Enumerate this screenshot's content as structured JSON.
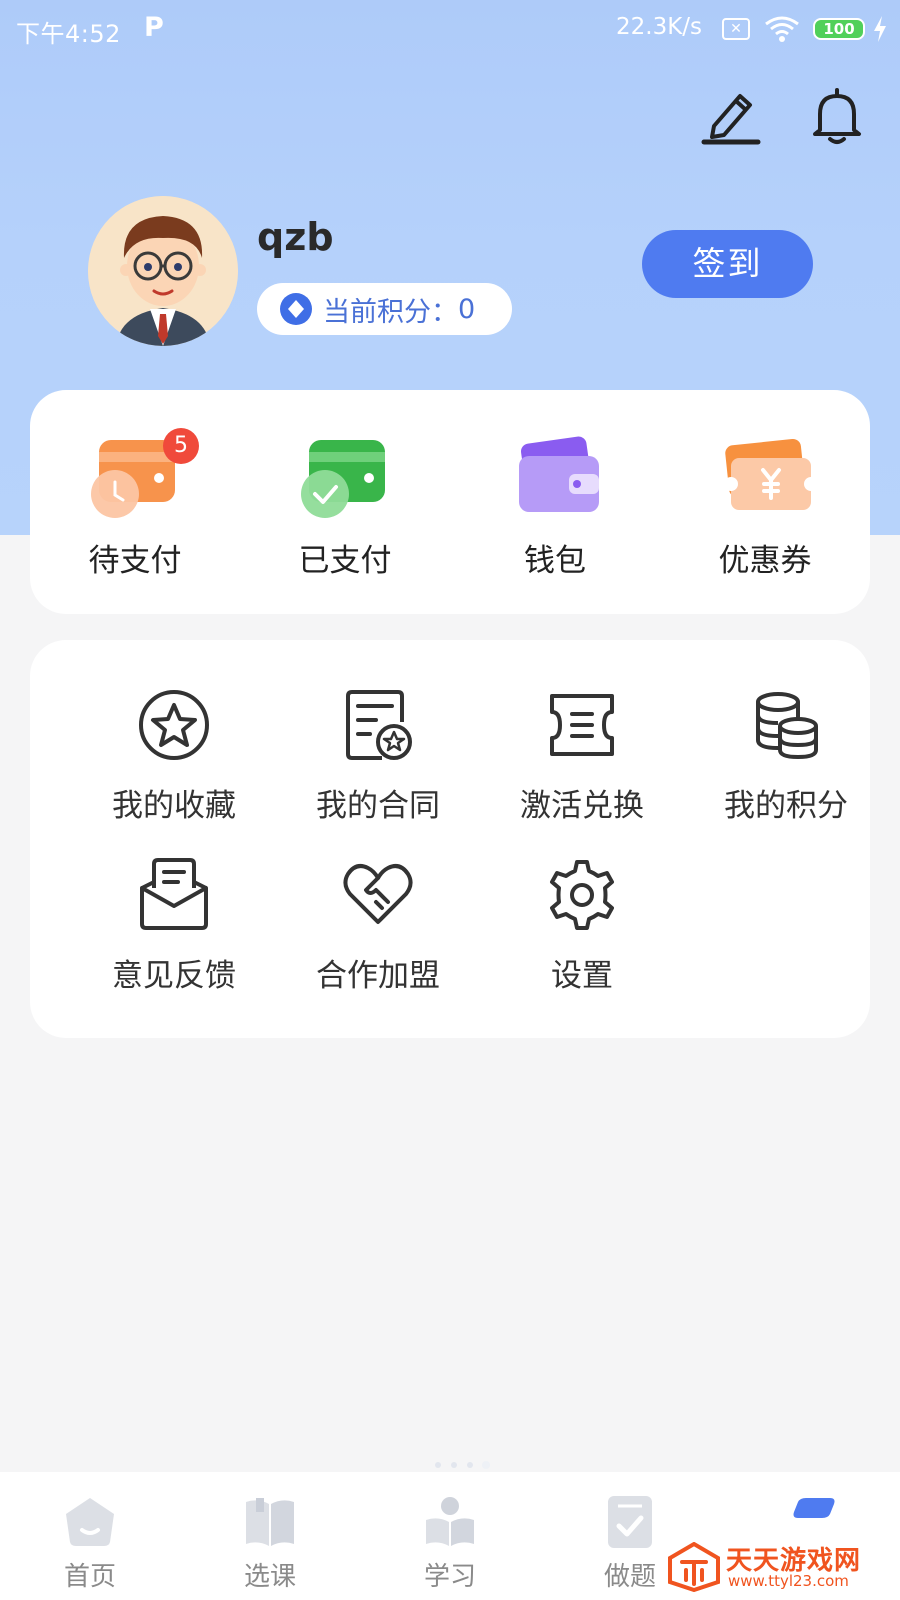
{
  "status_bar": {
    "time": "下午4:52",
    "app_badge": "P",
    "network_speed": "22.3K/s",
    "battery": "100"
  },
  "header": {
    "edit_icon": "edit-icon",
    "bell_icon": "bell-icon"
  },
  "profile": {
    "username": "qzb",
    "points_label": "当前积分：",
    "points_value": "0",
    "signin_label": "签到"
  },
  "payment_card": {
    "items": [
      {
        "label": "待支付",
        "icon": "pending-payment-icon",
        "badge": "5"
      },
      {
        "label": "已支付",
        "icon": "paid-icon"
      },
      {
        "label": "钱包",
        "icon": "wallet-icon"
      },
      {
        "label": "优惠券",
        "icon": "coupon-icon"
      }
    ]
  },
  "menu_card": {
    "items": [
      {
        "label": "我的收藏",
        "icon": "star-icon"
      },
      {
        "label": "我的合同",
        "icon": "contract-icon"
      },
      {
        "label": "激活兑换",
        "icon": "ticket-icon"
      },
      {
        "label": "我的积分",
        "icon": "coins-icon"
      },
      {
        "label": "意见反馈",
        "icon": "feedback-icon"
      },
      {
        "label": "合作加盟",
        "icon": "handshake-heart-icon"
      },
      {
        "label": "设置",
        "icon": "gear-icon"
      }
    ]
  },
  "tabbar": {
    "tabs": [
      {
        "label": "首页",
        "icon": "home-icon"
      },
      {
        "label": "选课",
        "icon": "book-icon"
      },
      {
        "label": "学习",
        "icon": "study-icon"
      },
      {
        "label": "做题",
        "icon": "exercise-icon"
      },
      {
        "label": "",
        "icon": "profile-icon"
      }
    ]
  },
  "watermark": {
    "text": "天天游戏网",
    "url": "www.ttyl23.com"
  },
  "colors": {
    "accent": "#4f7bf0",
    "header_bg": "#b3cffb",
    "page_bg": "#f5f5f6",
    "badge": "#f04a3b"
  }
}
